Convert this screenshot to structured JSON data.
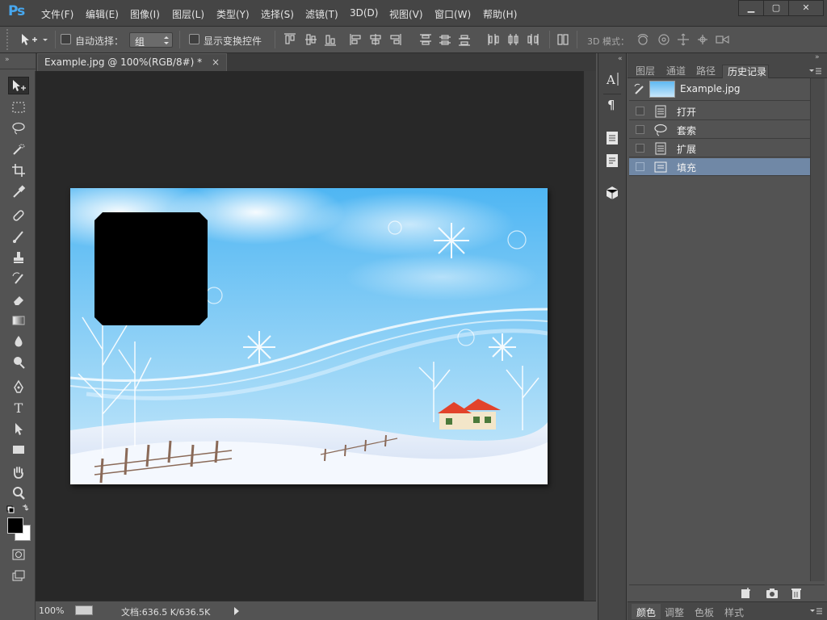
{
  "app": {
    "logo": "Ps"
  },
  "menu": [
    "文件(F)",
    "编辑(E)",
    "图像(I)",
    "图层(L)",
    "类型(Y)",
    "选择(S)",
    "滤镜(T)",
    "3D(D)",
    "视图(V)",
    "窗口(W)",
    "帮助(H)"
  ],
  "window_controls": {
    "minimize": "▁",
    "maximize": "▢",
    "close": "✕"
  },
  "options": {
    "auto_select_label": "自动选择：",
    "auto_select_value": "组",
    "show_transform_label": "显示变换控件",
    "mode_3d_label": "3D 模式："
  },
  "document": {
    "tab_title": "Example.jpg @ 100%(RGB/8#) *",
    "tab_close": "×"
  },
  "status": {
    "zoom": "100%",
    "doc_info": "文档:636.5 K/636.5K"
  },
  "panel": {
    "tabs": [
      "图层",
      "通道",
      "路径",
      "历史记录"
    ],
    "active_tab": "历史记录",
    "snapshot_name": "Example.jpg",
    "history": [
      {
        "label": "打开",
        "icon": "document-icon",
        "selected": false
      },
      {
        "label": "套索",
        "icon": "lasso-icon",
        "selected": false
      },
      {
        "label": "扩展",
        "icon": "document-icon",
        "selected": false
      },
      {
        "label": "填充",
        "icon": "fill-icon",
        "selected": true
      }
    ],
    "bottom_tabs": [
      "颜色",
      "调整",
      "色板",
      "样式"
    ]
  }
}
